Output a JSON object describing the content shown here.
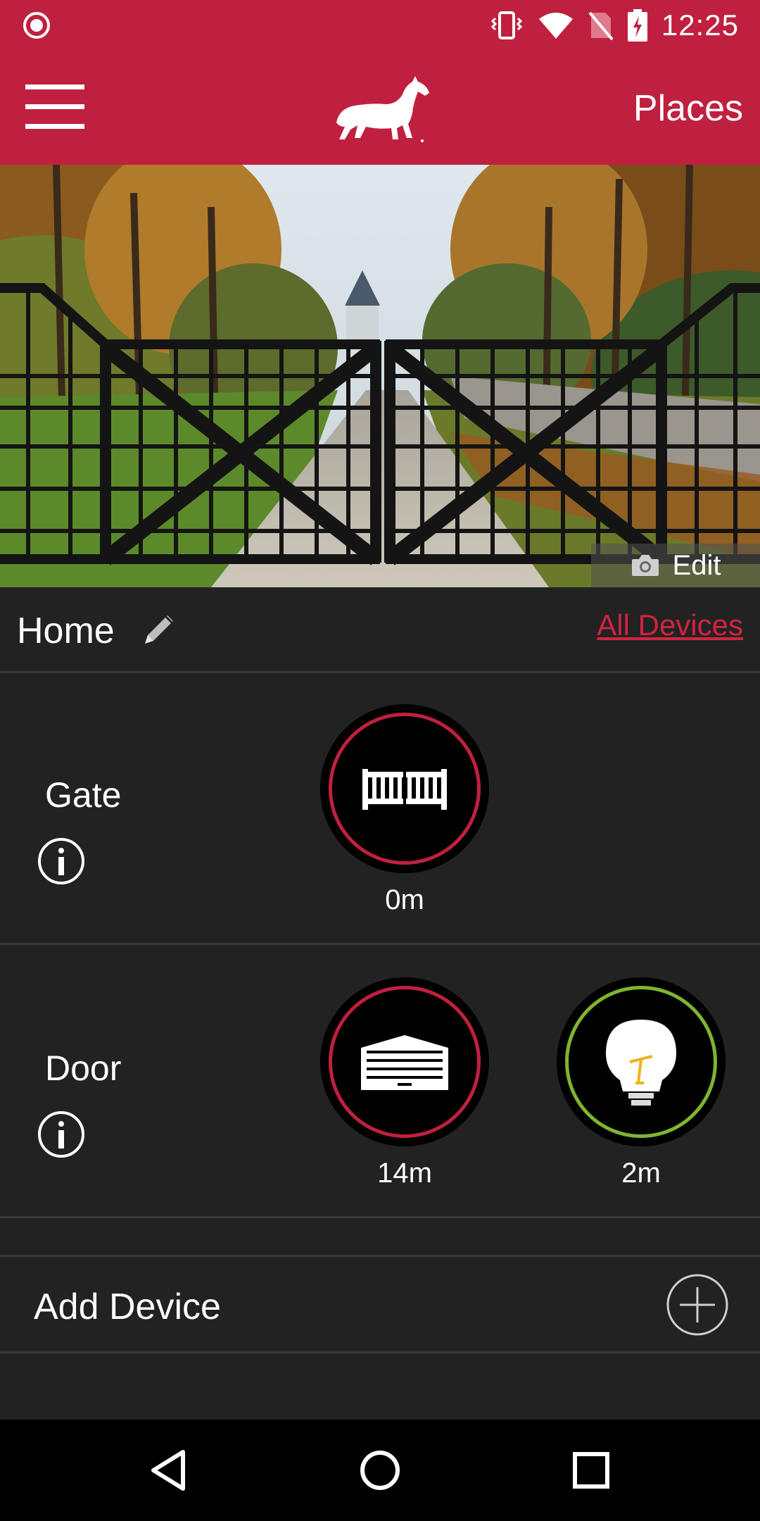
{
  "status_bar": {
    "time": "12:25",
    "icons": [
      "recording-icon",
      "vibrate-icon",
      "wifi-icon",
      "no-sim-icon",
      "battery-charging-icon"
    ]
  },
  "app_bar": {
    "menu_icon": "hamburger-menu-icon",
    "logo": "horse-logo",
    "places_label": "Places"
  },
  "hero": {
    "edit_label": "Edit",
    "edit_icon": "camera-icon"
  },
  "place": {
    "name": "Home",
    "rename_icon": "pencil-icon",
    "all_devices_label": "All Devices"
  },
  "groups": [
    {
      "name": "Gate",
      "devices": [
        {
          "icon": "gate-icon",
          "status": "closed",
          "age": "0m"
        }
      ]
    },
    {
      "name": "Door",
      "devices": [
        {
          "icon": "garage-door-icon",
          "status": "closed",
          "age": "14m"
        },
        {
          "icon": "light-bulb-icon",
          "status": "on",
          "age": "2m"
        }
      ]
    }
  ],
  "add_device": {
    "label": "Add Device",
    "icon": "plus-circle-icon"
  },
  "nav": [
    "back-icon",
    "home-icon",
    "recents-icon"
  ],
  "colors": {
    "brand": "#c0203f",
    "link": "#d2233f",
    "background": "#222222",
    "status_closed": "#c0203f",
    "status_on": "#7fb52d"
  }
}
